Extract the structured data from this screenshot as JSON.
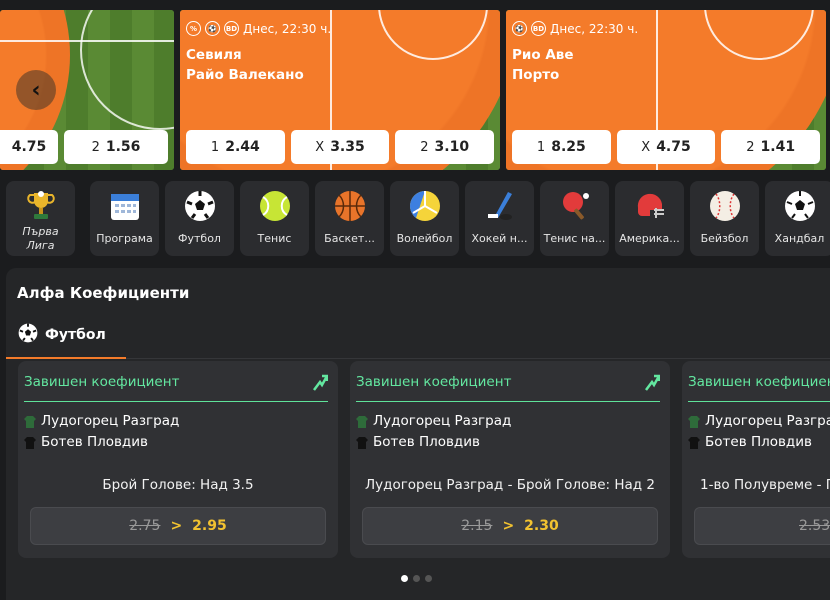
{
  "events": [
    {
      "meta_icons": [],
      "datetime": "",
      "team1": "",
      "team2": "",
      "odds": [
        {
          "label": "",
          "value": "4.75"
        },
        {
          "label": "2",
          "value": "1.56"
        }
      ]
    },
    {
      "meta_icons": [
        "%",
        "⚽",
        "BD"
      ],
      "datetime": "Днес, 22:30 ч.",
      "team1": "Севиля",
      "team2": "Райо Валекано",
      "odds": [
        {
          "label": "1",
          "value": "2.44"
        },
        {
          "label": "X",
          "value": "3.35"
        },
        {
          "label": "2",
          "value": "3.10"
        }
      ]
    },
    {
      "meta_icons": [
        "⚽",
        "BD"
      ],
      "datetime": "Днес, 22:30 ч.",
      "team1": "Рио Аве",
      "team2": "Порто",
      "odds": [
        {
          "label": "1",
          "value": "8.25"
        },
        {
          "label": "X",
          "value": "4.75"
        },
        {
          "label": "2",
          "value": "1.41"
        }
      ]
    }
  ],
  "sports": [
    {
      "label": "Първа Лига",
      "icon": "trophy-icon"
    },
    {
      "label": "Програма",
      "icon": "calendar-icon"
    },
    {
      "label": "Футбол",
      "icon": "soccer-ball-icon"
    },
    {
      "label": "Тенис",
      "icon": "tennis-ball-icon"
    },
    {
      "label": "Баскет...",
      "icon": "basketball-icon"
    },
    {
      "label": "Волейбол",
      "icon": "volleyball-icon"
    },
    {
      "label": "Хокей н...",
      "icon": "hockey-icon"
    },
    {
      "label": "Тенис на...",
      "icon": "table-tennis-icon"
    },
    {
      "label": "Америка...",
      "icon": "football-helmet-icon"
    },
    {
      "label": "Бейзбол",
      "icon": "baseball-icon"
    },
    {
      "label": "Хандбал",
      "icon": "handball-icon"
    }
  ],
  "alpha": {
    "title": "Алфа Коефициенти",
    "tab": "Футбол",
    "offers": [
      {
        "head": "Завишен коефициент",
        "team1": "Лудогорец Разград",
        "team2": "Ботев Пловдив",
        "market": "Брой Голове: Над 3.5",
        "old": "2.75",
        "arrow": ">",
        "new": "2.95"
      },
      {
        "head": "Завишен коефициент",
        "team1": "Лудогорец Разград",
        "team2": "Ботев Пловдив",
        "market": "Лудогорец Разград - Брой Голове: Над 2",
        "old": "2.15",
        "arrow": ">",
        "new": "2.30"
      },
      {
        "head": "Завишен коефициент",
        "team1": "Лудогорец Разград",
        "team2": "Ботев Пловдив",
        "market": "1-во Полувреме - Г",
        "old": "2.53",
        "arrow": "",
        "new": ""
      }
    ]
  },
  "colors": {
    "accent": "#f47b2a",
    "green": "#63e7a0",
    "yellow": "#f2c230",
    "panel": "#252628"
  },
  "pagination": {
    "count": 3,
    "active": 1
  }
}
